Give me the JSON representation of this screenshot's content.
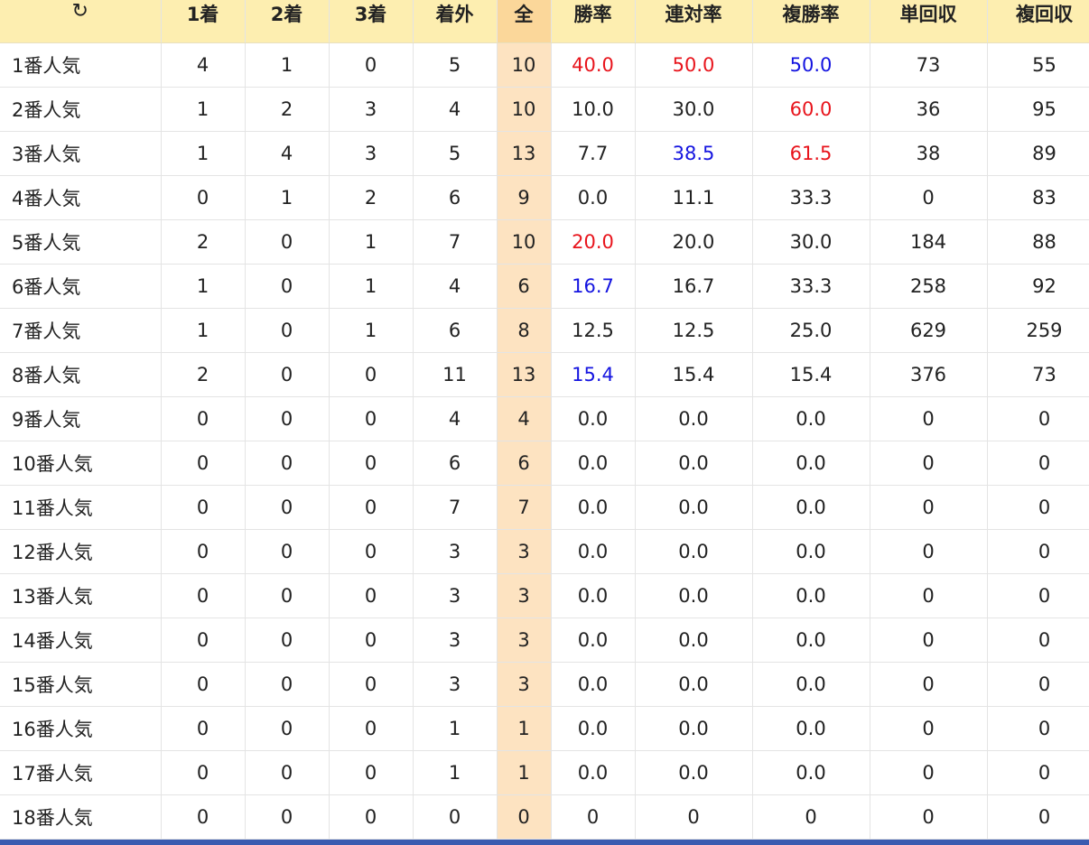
{
  "colors": {
    "header_bg": "#fdeeb0",
    "total_header_bg": "#fbd79a",
    "total_cell_bg": "#fde3c1",
    "highlight_red": "#e8141c",
    "highlight_blue": "#1414e0",
    "bottom_bar": "#3a5bb0"
  },
  "header": {
    "refresh_icon": "refresh-icon",
    "refresh_glyph": "↻",
    "columns": [
      "1着",
      "2着",
      "3着",
      "着外",
      "全",
      "勝率",
      "連対率",
      "複勝率",
      "単回収",
      "複回収"
    ]
  },
  "rows": [
    {
      "label": "1番人気",
      "cells": [
        "4",
        "1",
        "0",
        "5",
        "10",
        "40.0",
        "50.0",
        "50.0",
        "73",
        "55"
      ],
      "colors": [
        "",
        "",
        "",
        "",
        "",
        "red",
        "red",
        "blue",
        "",
        ""
      ]
    },
    {
      "label": "2番人気",
      "cells": [
        "1",
        "2",
        "3",
        "4",
        "10",
        "10.0",
        "30.0",
        "60.0",
        "36",
        "95"
      ],
      "colors": [
        "",
        "",
        "",
        "",
        "",
        "",
        "",
        "red",
        "",
        ""
      ]
    },
    {
      "label": "3番人気",
      "cells": [
        "1",
        "4",
        "3",
        "5",
        "13",
        "7.7",
        "38.5",
        "61.5",
        "38",
        "89"
      ],
      "colors": [
        "",
        "",
        "",
        "",
        "",
        "",
        "blue",
        "red",
        "",
        ""
      ]
    },
    {
      "label": "4番人気",
      "cells": [
        "0",
        "1",
        "2",
        "6",
        "9",
        "0.0",
        "11.1",
        "33.3",
        "0",
        "83"
      ],
      "colors": [
        "",
        "",
        "",
        "",
        "",
        "",
        "",
        "",
        "",
        ""
      ]
    },
    {
      "label": "5番人気",
      "cells": [
        "2",
        "0",
        "1",
        "7",
        "10",
        "20.0",
        "20.0",
        "30.0",
        "184",
        "88"
      ],
      "colors": [
        "",
        "",
        "",
        "",
        "",
        "red",
        "",
        "",
        "",
        ""
      ]
    },
    {
      "label": "6番人気",
      "cells": [
        "1",
        "0",
        "1",
        "4",
        "6",
        "16.7",
        "16.7",
        "33.3",
        "258",
        "92"
      ],
      "colors": [
        "",
        "",
        "",
        "",
        "",
        "blue",
        "",
        "",
        "",
        ""
      ]
    },
    {
      "label": "7番人気",
      "cells": [
        "1",
        "0",
        "1",
        "6",
        "8",
        "12.5",
        "12.5",
        "25.0",
        "629",
        "259"
      ],
      "colors": [
        "",
        "",
        "",
        "",
        "",
        "",
        "",
        "",
        "",
        ""
      ]
    },
    {
      "label": "8番人気",
      "cells": [
        "2",
        "0",
        "0",
        "11",
        "13",
        "15.4",
        "15.4",
        "15.4",
        "376",
        "73"
      ],
      "colors": [
        "",
        "",
        "",
        "",
        "",
        "blue",
        "",
        "",
        "",
        ""
      ]
    },
    {
      "label": "9番人気",
      "cells": [
        "0",
        "0",
        "0",
        "4",
        "4",
        "0.0",
        "0.0",
        "0.0",
        "0",
        "0"
      ],
      "colors": [
        "",
        "",
        "",
        "",
        "",
        "",
        "",
        "",
        "",
        ""
      ]
    },
    {
      "label": "10番人気",
      "cells": [
        "0",
        "0",
        "0",
        "6",
        "6",
        "0.0",
        "0.0",
        "0.0",
        "0",
        "0"
      ],
      "colors": [
        "",
        "",
        "",
        "",
        "",
        "",
        "",
        "",
        "",
        ""
      ]
    },
    {
      "label": "11番人気",
      "cells": [
        "0",
        "0",
        "0",
        "7",
        "7",
        "0.0",
        "0.0",
        "0.0",
        "0",
        "0"
      ],
      "colors": [
        "",
        "",
        "",
        "",
        "",
        "",
        "",
        "",
        "",
        ""
      ]
    },
    {
      "label": "12番人気",
      "cells": [
        "0",
        "0",
        "0",
        "3",
        "3",
        "0.0",
        "0.0",
        "0.0",
        "0",
        "0"
      ],
      "colors": [
        "",
        "",
        "",
        "",
        "",
        "",
        "",
        "",
        "",
        ""
      ]
    },
    {
      "label": "13番人気",
      "cells": [
        "0",
        "0",
        "0",
        "3",
        "3",
        "0.0",
        "0.0",
        "0.0",
        "0",
        "0"
      ],
      "colors": [
        "",
        "",
        "",
        "",
        "",
        "",
        "",
        "",
        "",
        ""
      ]
    },
    {
      "label": "14番人気",
      "cells": [
        "0",
        "0",
        "0",
        "3",
        "3",
        "0.0",
        "0.0",
        "0.0",
        "0",
        "0"
      ],
      "colors": [
        "",
        "",
        "",
        "",
        "",
        "",
        "",
        "",
        "",
        ""
      ]
    },
    {
      "label": "15番人気",
      "cells": [
        "0",
        "0",
        "0",
        "3",
        "3",
        "0.0",
        "0.0",
        "0.0",
        "0",
        "0"
      ],
      "colors": [
        "",
        "",
        "",
        "",
        "",
        "",
        "",
        "",
        "",
        ""
      ]
    },
    {
      "label": "16番人気",
      "cells": [
        "0",
        "0",
        "0",
        "1",
        "1",
        "0.0",
        "0.0",
        "0.0",
        "0",
        "0"
      ],
      "colors": [
        "",
        "",
        "",
        "",
        "",
        "",
        "",
        "",
        "",
        ""
      ]
    },
    {
      "label": "17番人気",
      "cells": [
        "0",
        "0",
        "0",
        "1",
        "1",
        "0.0",
        "0.0",
        "0.0",
        "0",
        "0"
      ],
      "colors": [
        "",
        "",
        "",
        "",
        "",
        "",
        "",
        "",
        "",
        ""
      ]
    },
    {
      "label": "18番人気",
      "cells": [
        "0",
        "0",
        "0",
        "0",
        "0",
        "0",
        "0",
        "0",
        "0",
        "0"
      ],
      "colors": [
        "",
        "",
        "",
        "",
        "",
        "",
        "",
        "",
        "",
        ""
      ]
    }
  ]
}
